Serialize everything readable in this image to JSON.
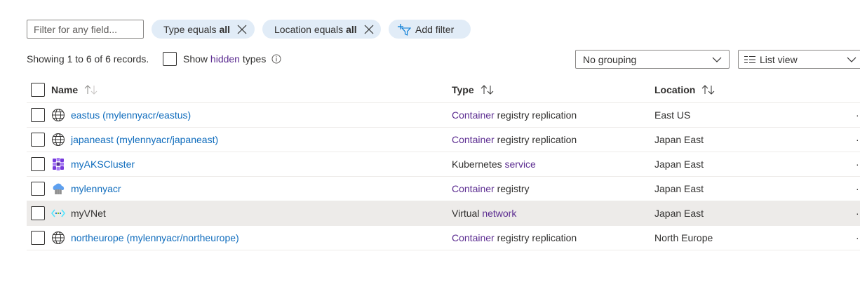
{
  "filter": {
    "placeholder": "Filter for any field..."
  },
  "pills": {
    "type": {
      "prefix": "Type equals",
      "value": "all"
    },
    "location": {
      "prefix": "Location equals",
      "value": "all"
    },
    "add": {
      "label": "Add filter"
    }
  },
  "records": {
    "summary": "Showing 1 to 6 of 6 records.",
    "show_prefix": "Show",
    "show_link": "hidden",
    "show_suffix": "types"
  },
  "grouping": {
    "selected": "No grouping"
  },
  "view": {
    "selected": "List view"
  },
  "table": {
    "columns": {
      "name": "Name",
      "type": "Type",
      "location": "Location"
    },
    "rows": [
      {
        "name": "eastus (mylennyacr/eastus)",
        "icon": "globe-icon",
        "type_link": "Container",
        "type_rest": "registry replication",
        "location": "East US"
      },
      {
        "name": "japaneast (mylennyacr/japaneast)",
        "icon": "globe-icon",
        "type_link": "Container",
        "type_rest": "registry replication",
        "location": "Japan East"
      },
      {
        "name": "myAKSCluster",
        "icon": "kubernetes-cluster-icon",
        "type_prefix": "Kubernetes",
        "type_link": "service",
        "location": "Japan East"
      },
      {
        "name": "mylennyacr",
        "icon": "container-registry-icon",
        "type_link": "Container",
        "type_rest": "registry",
        "location": "Japan East"
      },
      {
        "name": "myVNet",
        "icon": "virtual-network-icon",
        "type_prefix": "Virtual",
        "type_link": "network",
        "location": "Japan East"
      },
      {
        "name": "northeurope (mylennyacr/northeurope)",
        "icon": "globe-icon",
        "type_link": "Container",
        "type_rest": "registry replication",
        "location": "North Europe"
      }
    ],
    "more_glyph": "·"
  },
  "colors": {
    "link": "#0f6cbd",
    "type_link": "#5c2d91",
    "pill_bg": "#e1ecf7",
    "selected_row": "#edebe9"
  }
}
